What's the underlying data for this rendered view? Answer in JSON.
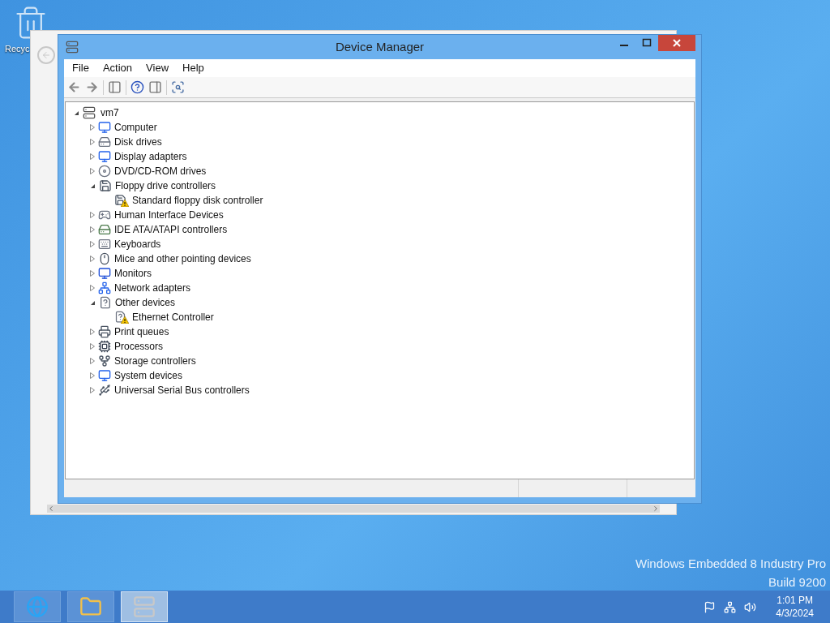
{
  "desktop": {
    "icons": [
      {
        "label": "Recyc"
      }
    ],
    "os_label": "Windows Embedded 8 Industry Pro",
    "build_label": "Build 9200"
  },
  "window": {
    "title": "Device Manager"
  },
  "menu": [
    "File",
    "Action",
    "View",
    "Help"
  ],
  "tree": {
    "label": "vm7",
    "expanded": true,
    "children": [
      {
        "label": "Computer",
        "expanded": false
      },
      {
        "label": "Disk drives",
        "expanded": false
      },
      {
        "label": "Display adapters",
        "expanded": false
      },
      {
        "label": "DVD/CD-ROM drives",
        "expanded": false
      },
      {
        "label": "Floppy drive controllers",
        "expanded": true,
        "children": [
          {
            "label": "Standard floppy disk controller",
            "warning": true
          }
        ]
      },
      {
        "label": "Human Interface Devices",
        "expanded": false
      },
      {
        "label": "IDE ATA/ATAPI controllers",
        "expanded": false
      },
      {
        "label": "Keyboards",
        "expanded": false
      },
      {
        "label": "Mice and other pointing devices",
        "expanded": false
      },
      {
        "label": "Monitors",
        "expanded": false
      },
      {
        "label": "Network adapters",
        "expanded": false
      },
      {
        "label": "Other devices",
        "expanded": true,
        "children": [
          {
            "label": "Ethernet Controller",
            "warning": true
          }
        ]
      },
      {
        "label": "Print queues",
        "expanded": false
      },
      {
        "label": "Processors",
        "expanded": false
      },
      {
        "label": "Storage controllers",
        "expanded": false
      },
      {
        "label": "System devices",
        "expanded": false
      },
      {
        "label": "Universal Serial Bus controllers",
        "expanded": false
      }
    ]
  },
  "taskbar": {
    "apps": [
      {
        "selected": false
      },
      {
        "selected": false
      },
      {
        "selected": true
      }
    ],
    "time": "1:01 PM",
    "date": "4/3/2024"
  }
}
